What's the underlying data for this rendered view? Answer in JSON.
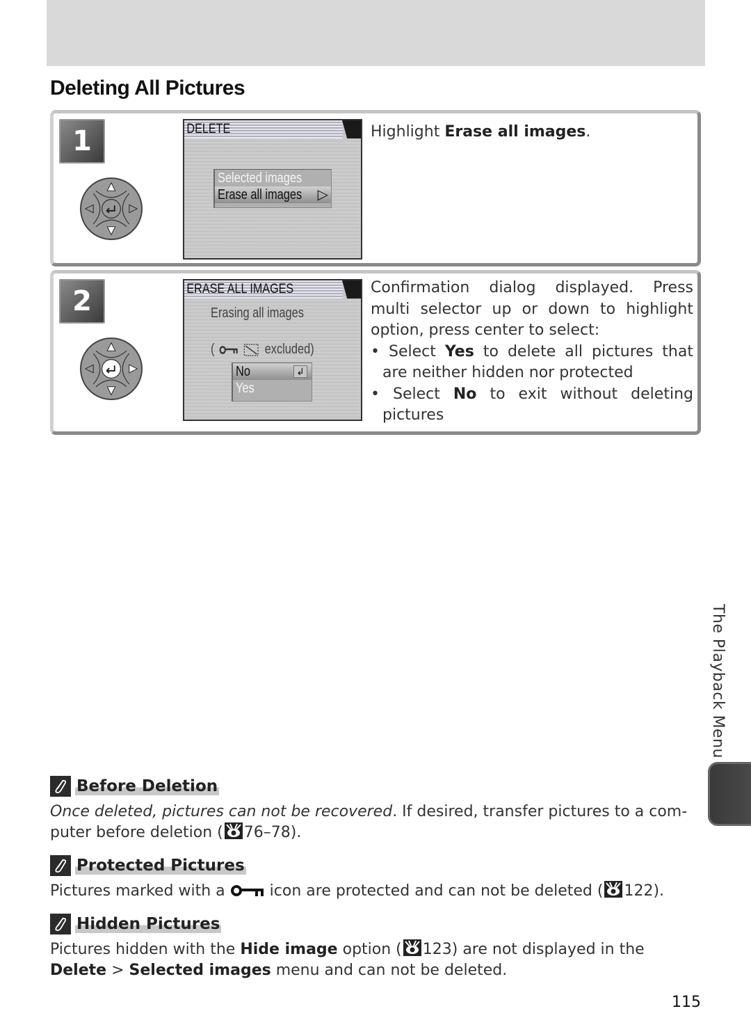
{
  "page": {
    "title": "Deleting All Pictures",
    "section_tab": "The Playback Menu",
    "page_number": "115"
  },
  "steps": [
    {
      "number": "1",
      "lcd": {
        "title": "DELETE",
        "menu_items": [
          {
            "label": "Selected images",
            "selected": false
          },
          {
            "label": "Erase all images",
            "selected": true
          }
        ]
      },
      "text_prefix": "Highlight ",
      "text_bold": "Erase all images",
      "text_suffix": "."
    },
    {
      "number": "2",
      "lcd": {
        "title": "ERASE ALL IMAGES",
        "message": "Erasing all images",
        "exclusion_open": "(",
        "exclusion_close": "excluded)",
        "menu_items": [
          {
            "label": "No",
            "selected": true
          },
          {
            "label": "Yes",
            "selected": false
          }
        ]
      },
      "intro": "Confirmation dialog displayed.  Press multi selector up or down to highlight option, press center to select:",
      "bullets": [
        {
          "prefix": "Select ",
          "bold": "Yes",
          "suffix": " to delete all pictures that are neither hidden nor protected"
        },
        {
          "prefix": "Select ",
          "bold": "No",
          "suffix": " to exit without deleting pictures"
        }
      ]
    }
  ],
  "notes": [
    {
      "title": "Before Deletion",
      "italic": "Once deleted, pictures can not be recovered",
      "text_a": ".  If desired, transfer pictures to a com-puter before deletion (",
      "ref": "76–78",
      "text_b": ")."
    },
    {
      "title": "Protected Pictures",
      "text_a": "Pictures marked with a ",
      "text_b": " icon are protected and can not be deleted (",
      "ref": "122",
      "text_c": ")."
    },
    {
      "title": "Hidden Pictures",
      "text_a": "Pictures hidden with the ",
      "bold_a": "Hide image",
      "text_b": " option (",
      "ref": "123",
      "text_c": ") are not displayed in the ",
      "bold_b": "Delete",
      "text_d": " > ",
      "bold_c": "Selected images",
      "text_e": " menu and can not be deleted."
    }
  ]
}
